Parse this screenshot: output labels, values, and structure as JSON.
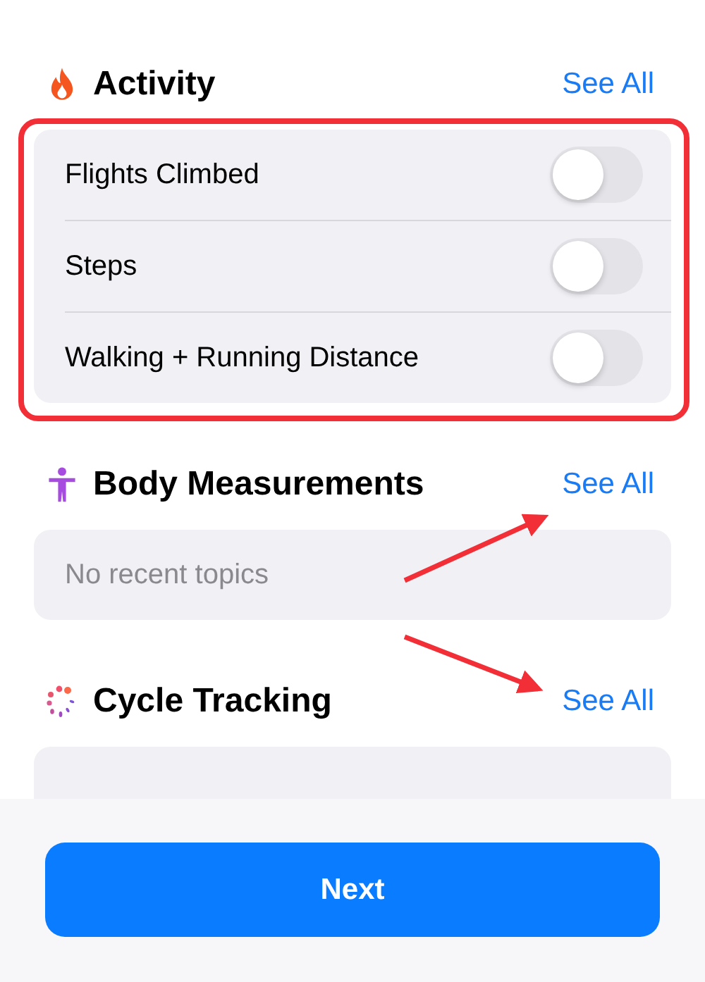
{
  "sections": [
    {
      "title": "Activity",
      "link": "See All",
      "items": [
        {
          "label": "Flights Climbed",
          "on": false
        },
        {
          "label": "Steps",
          "on": false
        },
        {
          "label": "Walking + Running Distance",
          "on": false
        }
      ]
    },
    {
      "title": "Body Measurements",
      "link": "See All",
      "empty_text": "No recent topics"
    },
    {
      "title": "Cycle Tracking",
      "link": "See All"
    }
  ],
  "button": "Next"
}
